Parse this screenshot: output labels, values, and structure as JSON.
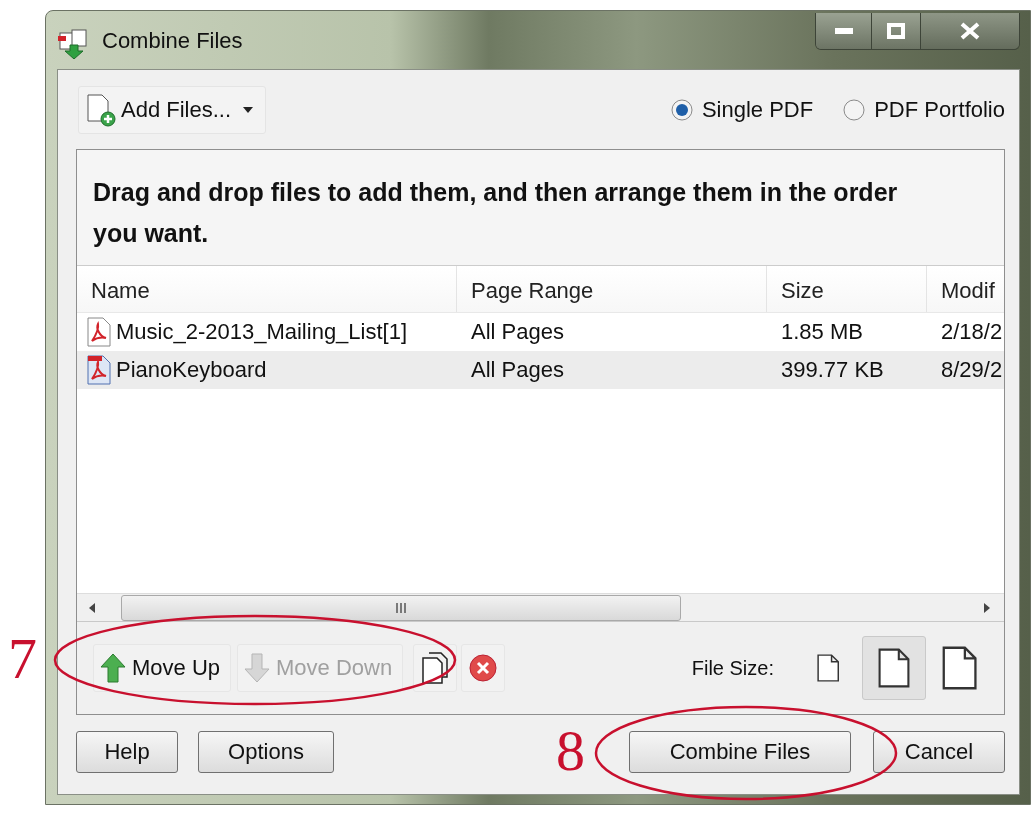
{
  "window": {
    "title": "Combine Files"
  },
  "toolbar": {
    "add_button": "Add Files...",
    "output_options": [
      {
        "label": "Single PDF",
        "selected": true
      },
      {
        "label": "PDF Portfolio",
        "selected": false
      }
    ]
  },
  "instructions": "Drag and drop files to add them, and then arrange them in the order you want.",
  "table": {
    "columns": [
      "Name",
      "Page Range",
      "Size",
      "Modif"
    ],
    "rows": [
      {
        "cells": [
          "Music_2-2013_Mailing_List[1]",
          "All Pages",
          "1.85 MB",
          "2/18/2"
        ],
        "selected": false
      },
      {
        "cells": [
          "PianoKeyboard",
          "All Pages",
          "399.77 KB",
          "8/29/2"
        ],
        "selected": true
      }
    ]
  },
  "move_buttons": [
    {
      "label": "Move Up",
      "disabled": false
    },
    {
      "label": "Move Down",
      "disabled": true
    }
  ],
  "file_size": {
    "label": "File Size:",
    "options": [
      {
        "selected": false
      },
      {
        "selected": true
      },
      {
        "selected": false
      }
    ]
  },
  "buttons_left": [
    "Help",
    "Options"
  ],
  "buttons_right": [
    "Combine Files",
    "Cancel"
  ],
  "annotations": [
    {
      "label": "7"
    },
    {
      "label": "8"
    }
  ]
}
